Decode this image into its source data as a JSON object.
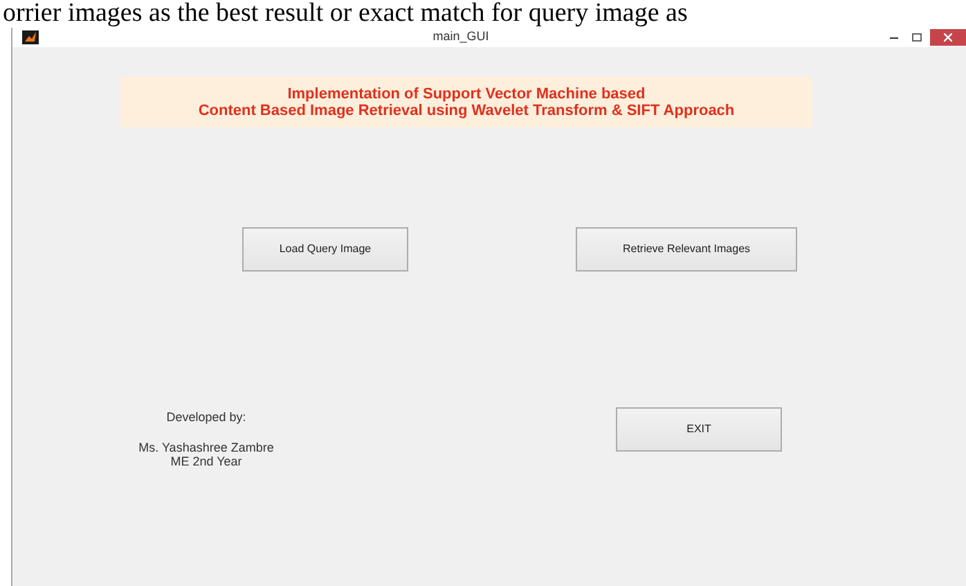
{
  "document_text": "orrier images as the best result or exact match for query image as",
  "window": {
    "title": "main_GUI"
  },
  "banner": {
    "lines": [
      "Implementation of Support Vector Machine based",
      "Content Based Image Retrieval using Wavelet Transform & SIFT Approach"
    ]
  },
  "buttons": [
    {
      "label": "Load Query Image"
    },
    {
      "label": "Retrieve Relevant Images"
    },
    {
      "label": "EXIT"
    }
  ],
  "credits": {
    "heading": "Developed by:",
    "name": "Ms. Yashashree Zambre",
    "detail": "ME 2nd Year"
  }
}
